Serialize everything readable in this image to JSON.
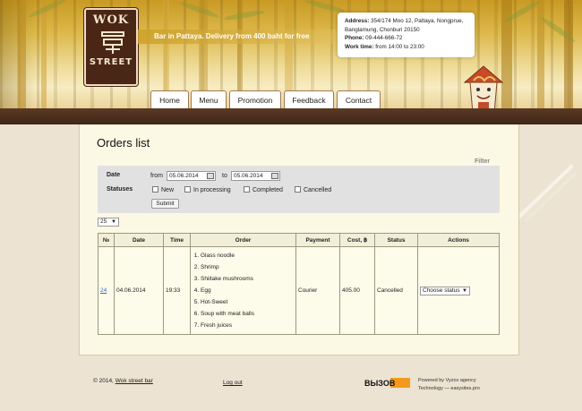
{
  "brand": {
    "logo_top": "WOK",
    "logo_bottom": "STREET",
    "tagline": "Bar in Pattaya. Delivery from 400 baht for free"
  },
  "contact": {
    "address_label": "Address:",
    "address_value": "354/174 Moo 12, Pattaya, Nongprue, Banglamung, Chonburi 20150",
    "phone_label": "Phone:",
    "phone_value": "09-444-666-72",
    "worktime_label": "Work time:",
    "worktime_value": "from 14:00 to 23:00"
  },
  "nav": [
    {
      "label": "Home"
    },
    {
      "label": "Menu"
    },
    {
      "label": "Promotion"
    },
    {
      "label": "Feedback"
    },
    {
      "label": "Contact"
    }
  ],
  "page": {
    "title": "Orders list",
    "filter_label": "Filter"
  },
  "filter": {
    "date_label": "Date",
    "from_label": "from",
    "from_value": "05.06.2014",
    "to_label": "to",
    "to_value": "05.06.2014",
    "statuses_label": "Statuses",
    "statuses": [
      {
        "label": "New",
        "checked": false
      },
      {
        "label": "In processing",
        "checked": false
      },
      {
        "label": "Completed",
        "checked": false
      },
      {
        "label": "Cancelled",
        "checked": false
      }
    ],
    "submit_label": "Submit",
    "per_page": "25"
  },
  "table": {
    "headers": [
      "№",
      "Date",
      "Time",
      "Order",
      "Payment",
      "Cost, ฿",
      "Status",
      "Actions"
    ],
    "rows": [
      {
        "id": "24",
        "date": "04.06.2014",
        "time": "19:33",
        "items": [
          "Glass noodle",
          "Shrimp",
          "Shiitake mushrooms",
          "Egg",
          "Hot-Sweet",
          "Soup with meat balls",
          "Fresh juices"
        ],
        "payment": "Courier",
        "cost": "405.00",
        "status": "Cancelled",
        "action": "Choose status"
      }
    ]
  },
  "footer": {
    "copyright": "© 2014,",
    "site_link": "Wok street bar",
    "logout": "Log out",
    "agency_logo": "ВЫЗОВ",
    "powered_line1": "Powered by Vyzov agency",
    "powered_line2": "Technology — easysites.pro"
  },
  "colors": {
    "brown": "#4a2616",
    "accent_orange": "#f39a1e",
    "content_bg": "#fbf8e4",
    "link": "#4169c8"
  }
}
